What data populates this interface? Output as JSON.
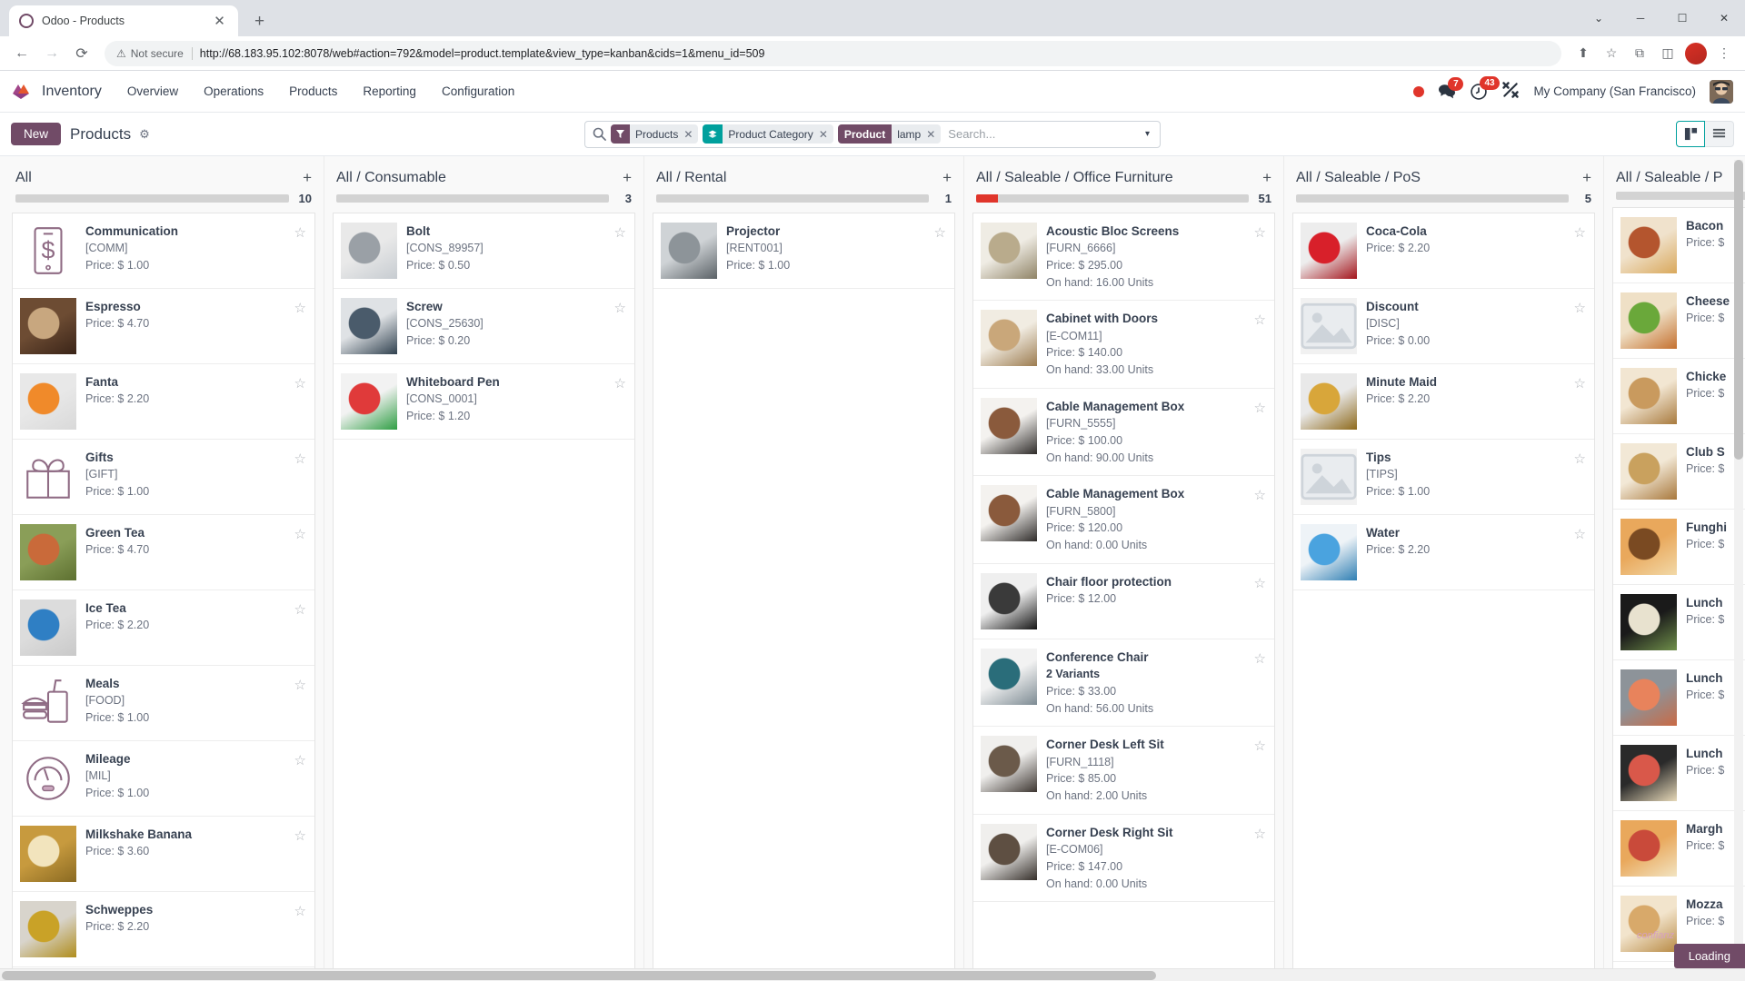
{
  "browser": {
    "tab_title": "Odoo - Products",
    "tab_close": "✕",
    "new_tab": "+",
    "back": "←",
    "forward": "→",
    "reload": "⟳",
    "security_label": "Not secure",
    "security_icon": "⚠",
    "url": "http://68.183.95.102:8078/web#action=792&model=product.template&view_type=kanban&cids=1&menu_id=509",
    "share_icon": "⬆",
    "bookmark_icon": "☆",
    "extensions_icon": "⧉",
    "sidepanel_icon": "◫",
    "menu_icon": "⋮",
    "win_minimize": "─",
    "win_maximize": "☐",
    "win_close": "✕",
    "win_chevron": "⌄"
  },
  "navbar": {
    "app_name": "Inventory",
    "menu": [
      {
        "label": "Overview"
      },
      {
        "label": "Operations"
      },
      {
        "label": "Products"
      },
      {
        "label": "Reporting"
      },
      {
        "label": "Configuration"
      }
    ],
    "messages_badge": "7",
    "activities_badge": "43",
    "company": "My Company (San Francisco)"
  },
  "control_panel": {
    "new_label": "New",
    "breadcrumb": "Products",
    "gear_icon": "⚙",
    "search": {
      "placeholder": "Search...",
      "facets": [
        {
          "type": "filter",
          "icon": "▼",
          "label": "Products",
          "remove": "✕"
        },
        {
          "type": "groupby",
          "icon": "☲",
          "label": "Product Category",
          "remove": "✕"
        },
        {
          "type": "field",
          "field": "Product",
          "label": "lamp",
          "remove": "✕"
        }
      ],
      "dropdown_caret": "▾"
    },
    "views": [
      {
        "name": "kanban",
        "active": true
      },
      {
        "name": "list",
        "active": false
      }
    ]
  },
  "board": {
    "add_icon": "+",
    "star_icon": "☆",
    "loading_label": "Loading",
    "watermark": "confianz",
    "columns": [
      {
        "title": "All",
        "count": "10",
        "progress": [],
        "cards": [
          {
            "name": "Communication",
            "ref": "[COMM]",
            "price": "Price: $ 1.00",
            "thumb": "icon-phone-dollar"
          },
          {
            "name": "Espresso",
            "ref": "",
            "price": "Price: $ 4.70",
            "thumb": "photo-espresso"
          },
          {
            "name": "Fanta",
            "ref": "",
            "price": "Price: $ 2.20",
            "thumb": "photo-fanta"
          },
          {
            "name": "Gifts",
            "ref": "[GIFT]",
            "price": "Price: $ 1.00",
            "thumb": "icon-gift"
          },
          {
            "name": "Green Tea",
            "ref": "",
            "price": "Price: $ 4.70",
            "thumb": "photo-greentea"
          },
          {
            "name": "Ice Tea",
            "ref": "",
            "price": "Price: $ 2.20",
            "thumb": "photo-icetea"
          },
          {
            "name": "Meals",
            "ref": "[FOOD]",
            "price": "Price: $ 1.00",
            "thumb": "icon-meal"
          },
          {
            "name": "Mileage",
            "ref": "[MIL]",
            "price": "Price: $ 1.00",
            "thumb": "icon-gauge"
          },
          {
            "name": "Milkshake Banana",
            "ref": "",
            "price": "Price: $ 3.60",
            "thumb": "photo-milkshake"
          },
          {
            "name": "Schweppes",
            "ref": "",
            "price": "Price: $ 2.20",
            "thumb": "photo-schweppes"
          }
        ]
      },
      {
        "title": "All / Consumable",
        "count": "3",
        "progress": [],
        "cards": [
          {
            "name": "Bolt",
            "ref": "[CONS_89957]",
            "price": "Price: $ 0.50",
            "thumb": "photo-bolt"
          },
          {
            "name": "Screw",
            "ref": "[CONS_25630]",
            "price": "Price: $ 0.20",
            "thumb": "photo-screw"
          },
          {
            "name": "Whiteboard Pen",
            "ref": "[CONS_0001]",
            "price": "Price: $ 1.20",
            "thumb": "photo-pen"
          }
        ]
      },
      {
        "title": "All / Rental",
        "count": "1",
        "progress": [],
        "cards": [
          {
            "name": "Projector",
            "ref": "[RENT001]",
            "price": "Price: $ 1.00",
            "thumb": "photo-projector"
          }
        ]
      },
      {
        "title": "All / Saleable / Office Furniture",
        "count": "51",
        "progress": [
          {
            "color": "#e0352b",
            "width": "8%"
          }
        ],
        "cards": [
          {
            "name": "Acoustic Bloc Screens",
            "ref": "[FURN_6666]",
            "price": "Price: $ 295.00",
            "onhand": "On hand: 16.00 Units",
            "thumb": "photo-screens"
          },
          {
            "name": "Cabinet with Doors",
            "ref": "[E-COM11]",
            "price": "Price: $ 140.00",
            "onhand": "On hand: 33.00 Units",
            "thumb": "photo-cabinet"
          },
          {
            "name": "Cable Management Box",
            "ref": "[FURN_5555]",
            "price": "Price: $ 100.00",
            "onhand": "On hand: 90.00 Units",
            "thumb": "photo-cablebox"
          },
          {
            "name": "Cable Management Box",
            "ref": "[FURN_5800]",
            "price": "Price: $ 120.00",
            "onhand": "On hand: 0.00 Units",
            "thumb": "photo-cablebox"
          },
          {
            "name": "Chair floor protection",
            "ref": "",
            "price": "Price: $ 12.00",
            "thumb": "photo-floormat"
          },
          {
            "name": "Conference Chair",
            "variants": "2 Variants",
            "price": "Price: $ 33.00",
            "onhand": "On hand: 56.00 Units",
            "thumb": "photo-chair"
          },
          {
            "name": "Corner Desk Left Sit",
            "ref": "[FURN_1118]",
            "price": "Price: $ 85.00",
            "onhand": "On hand: 2.00 Units",
            "thumb": "photo-desk"
          },
          {
            "name": "Corner Desk Right Sit",
            "ref": "[E-COM06]",
            "price": "Price: $ 147.00",
            "onhand": "On hand: 0.00 Units",
            "thumb": "photo-desk2"
          }
        ]
      },
      {
        "title": "All / Saleable / PoS",
        "count": "5",
        "progress": [],
        "cards": [
          {
            "name": "Coca-Cola",
            "ref": "",
            "price": "Price: $ 2.20",
            "thumb": "photo-coke"
          },
          {
            "name": "Discount",
            "ref": "[DISC]",
            "price": "Price: $ 0.00",
            "thumb": "placeholder"
          },
          {
            "name": "Minute Maid",
            "ref": "",
            "price": "Price: $ 2.20",
            "thumb": "photo-minutemaid"
          },
          {
            "name": "Tips",
            "ref": "[TIPS]",
            "price": "Price: $ 1.00",
            "thumb": "placeholder"
          },
          {
            "name": "Water",
            "ref": "",
            "price": "Price: $ 2.20",
            "thumb": "photo-water"
          }
        ]
      },
      {
        "title": "All / Saleable / P",
        "count": "",
        "progress": [],
        "cards": [
          {
            "name": "Bacon",
            "ref": "",
            "price": "Price: $",
            "thumb": "photo-bacon"
          },
          {
            "name": "Cheese",
            "ref": "",
            "price": "Price: $",
            "thumb": "photo-cheeseburger"
          },
          {
            "name": "Chicke",
            "ref": "",
            "price": "Price: $",
            "thumb": "photo-chicken"
          },
          {
            "name": "Club S",
            "ref": "",
            "price": "Price: $",
            "thumb": "photo-club"
          },
          {
            "name": "Funghi",
            "ref": "",
            "price": "Price: $",
            "thumb": "photo-funghi"
          },
          {
            "name": "Lunch",
            "ref": "",
            "price": "Price: $",
            "thumb": "photo-sushi1"
          },
          {
            "name": "Lunch",
            "ref": "",
            "price": "Price: $",
            "thumb": "photo-sushi2"
          },
          {
            "name": "Lunch",
            "ref": "",
            "price": "Price: $",
            "thumb": "photo-sushi3"
          },
          {
            "name": "Margh",
            "ref": "",
            "price": "Price: $",
            "thumb": "photo-margherita"
          },
          {
            "name": "Mozza",
            "ref": "",
            "price": "Price: $",
            "thumb": "photo-mozza"
          }
        ]
      }
    ]
  }
}
